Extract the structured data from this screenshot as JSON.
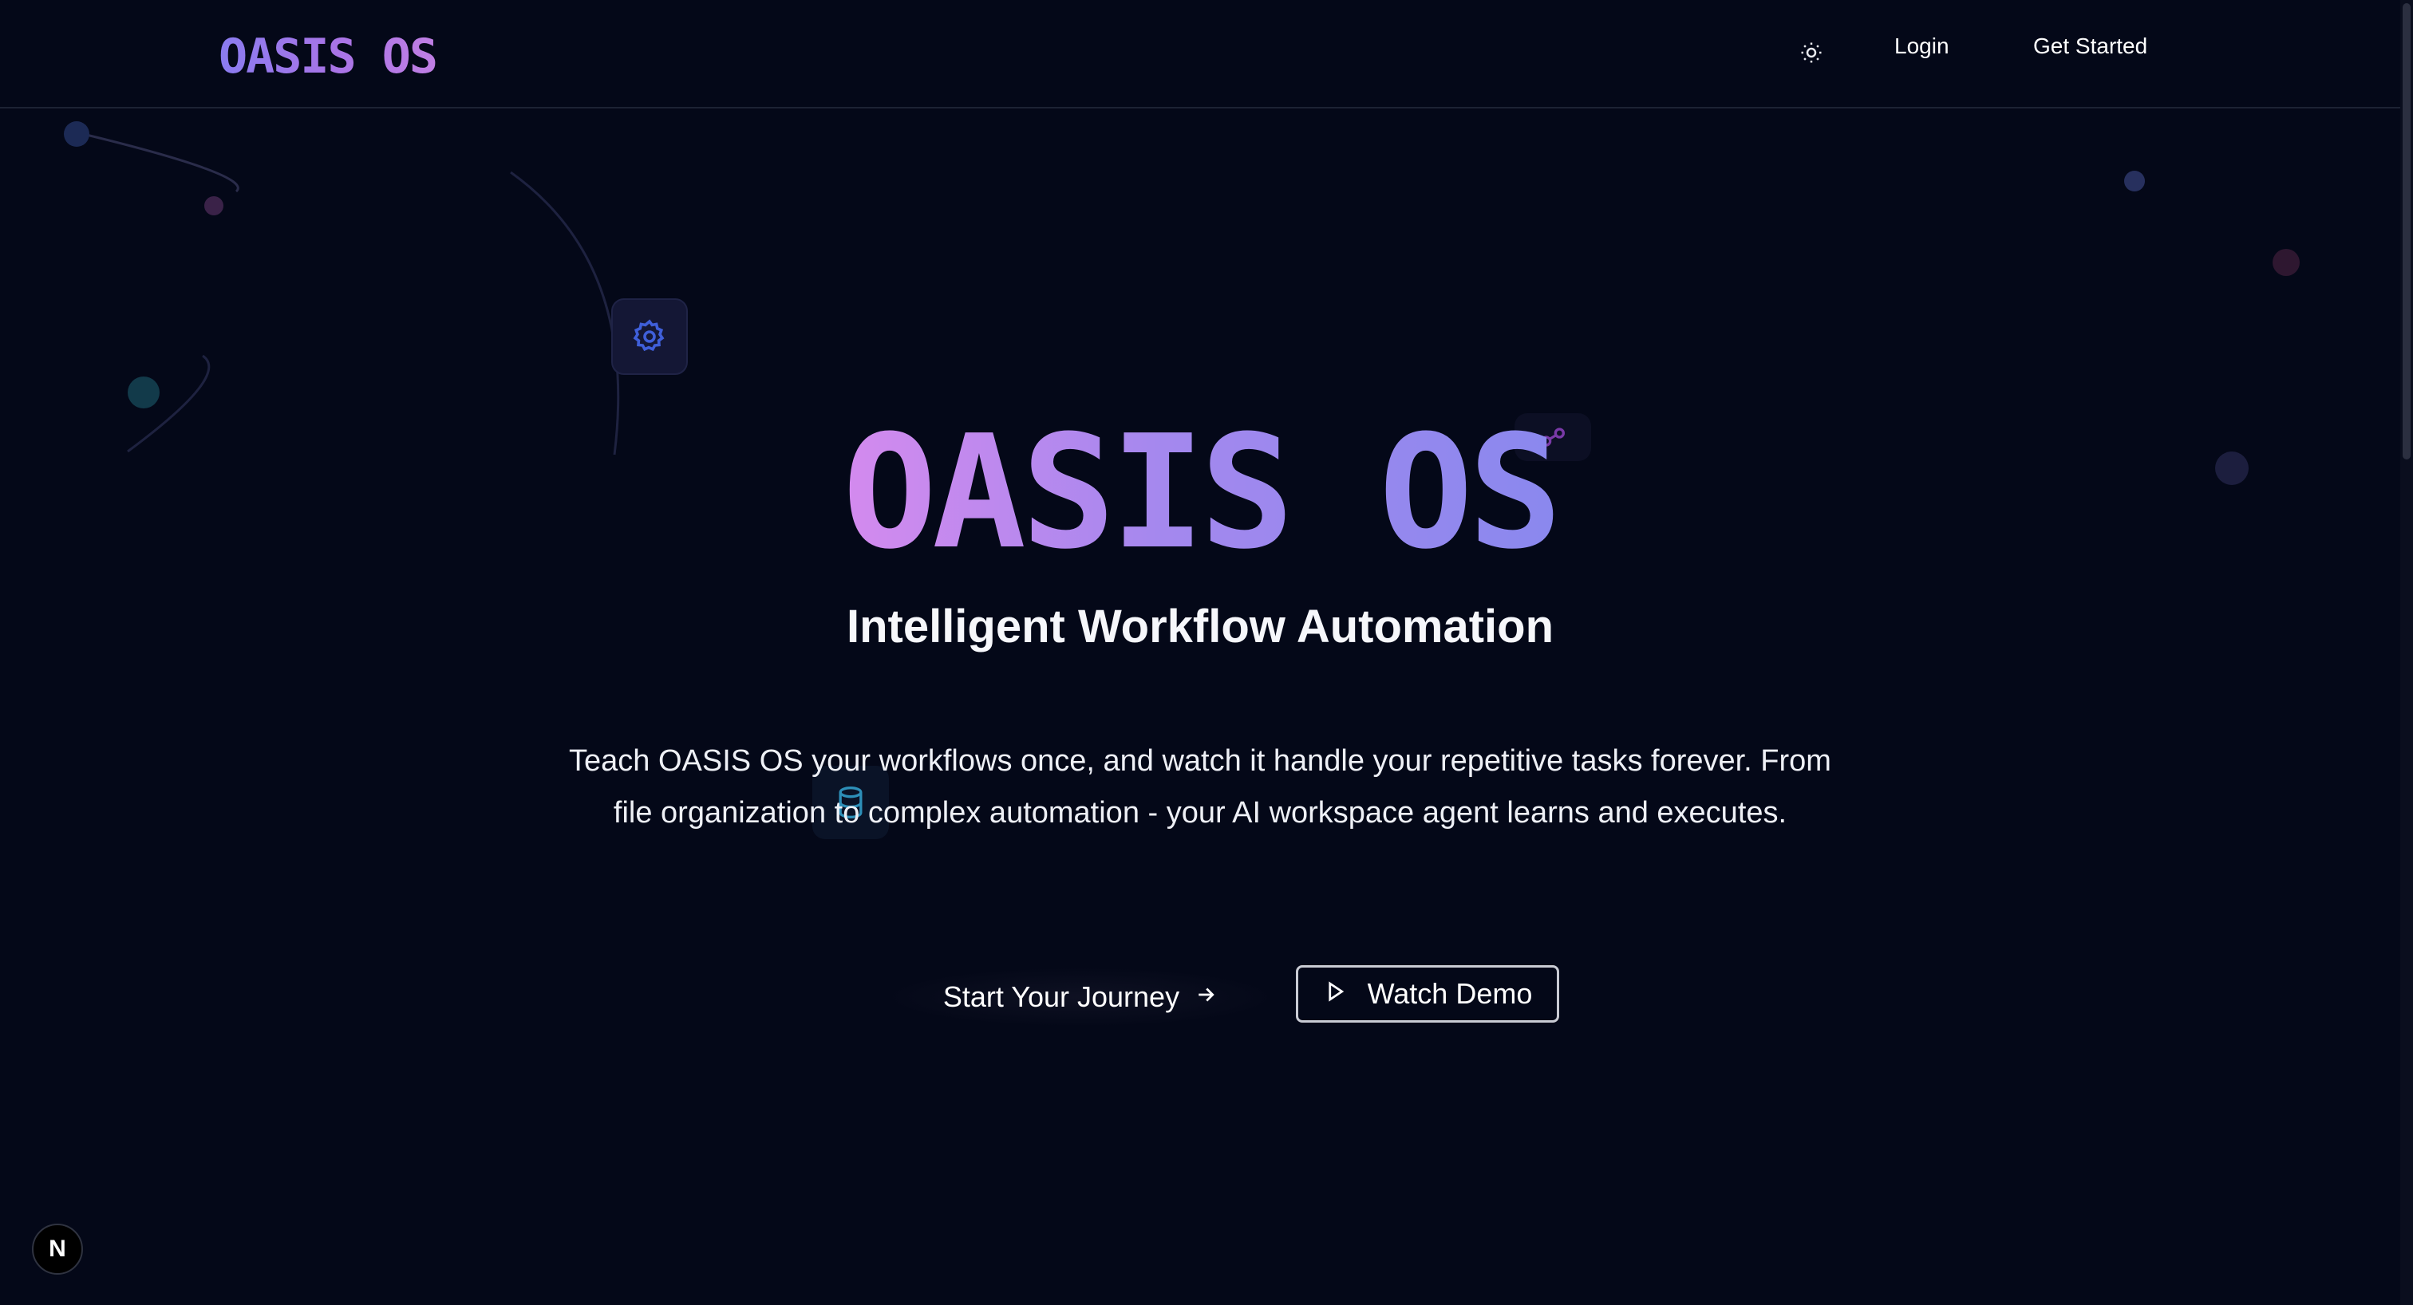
{
  "nav": {
    "logo": "OASIS OS",
    "theme_icon": "sun-icon",
    "login_label": "Login",
    "get_started_label": "Get Started"
  },
  "hero": {
    "title": "OASIS OS",
    "subtitle": "Intelligent Workflow Automation",
    "description": "Teach OASIS OS your workflows once, and watch it handle your repetitive tasks forever. From file organization to complex automation - your AI workspace agent learns and executes.",
    "primary_button_label": "Start Your Journey",
    "primary_button_icon": "arrow-right-icon",
    "secondary_button_label": "Watch Demo",
    "secondary_button_icon": "play-icon"
  },
  "decor_icons": [
    "gear-icon",
    "link-icon",
    "database-icon"
  ],
  "badge": {
    "label": "N"
  },
  "colors": {
    "background": "#040818",
    "gradient_start": "#d48aee",
    "gradient_end": "#8a88ee",
    "accent_blue": "#3b5bdb"
  }
}
